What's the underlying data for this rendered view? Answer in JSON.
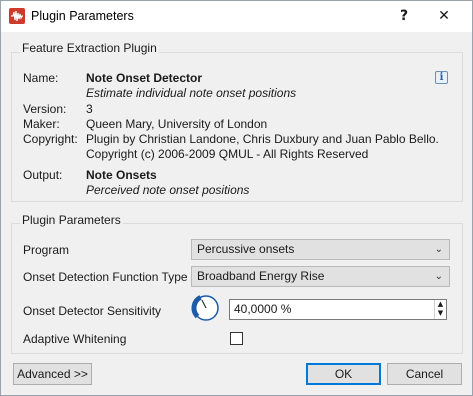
{
  "window": {
    "title": "Plugin Parameters",
    "help_label": "?",
    "close_label": "✕"
  },
  "feature": {
    "group_title": "Feature Extraction Plugin",
    "name_label": "Name:",
    "name_value": "Note Onset Detector",
    "description": "Estimate individual note onset positions",
    "version_label": "Version:",
    "version_value": "3",
    "maker_label": "Maker:",
    "maker_value": "Queen Mary, University of London",
    "copyright_label": "Copyright:",
    "copyright_line1": "Plugin by Christian Landone, Chris Duxbury and Juan Pablo Bello.",
    "copyright_line2": "Copyright (c) 2006-2009 QMUL - All Rights Reserved",
    "output_label": "Output:",
    "output_value": "Note Onsets",
    "output_description": "Perceived note onset positions",
    "info_icon": "i"
  },
  "params": {
    "group_title": "Plugin Parameters",
    "program_label": "Program",
    "program_value": "Percussive onsets",
    "odf_label": "Onset Detection Function Type",
    "odf_value": "Broadband Energy Rise",
    "sensitivity_label": "Onset Detector Sensitivity",
    "sensitivity_value": "40,0000 %",
    "sensitivity_level": 0.4,
    "whitening_label": "Adaptive Whitening",
    "whitening_checked": false
  },
  "buttons": {
    "advanced": "Advanced >>",
    "ok": "OK",
    "cancel": "Cancel"
  },
  "colors": {
    "accent": "#0078d7",
    "knob_blue": "#1e5aa8",
    "app_icon_red": "#d03a2b"
  }
}
